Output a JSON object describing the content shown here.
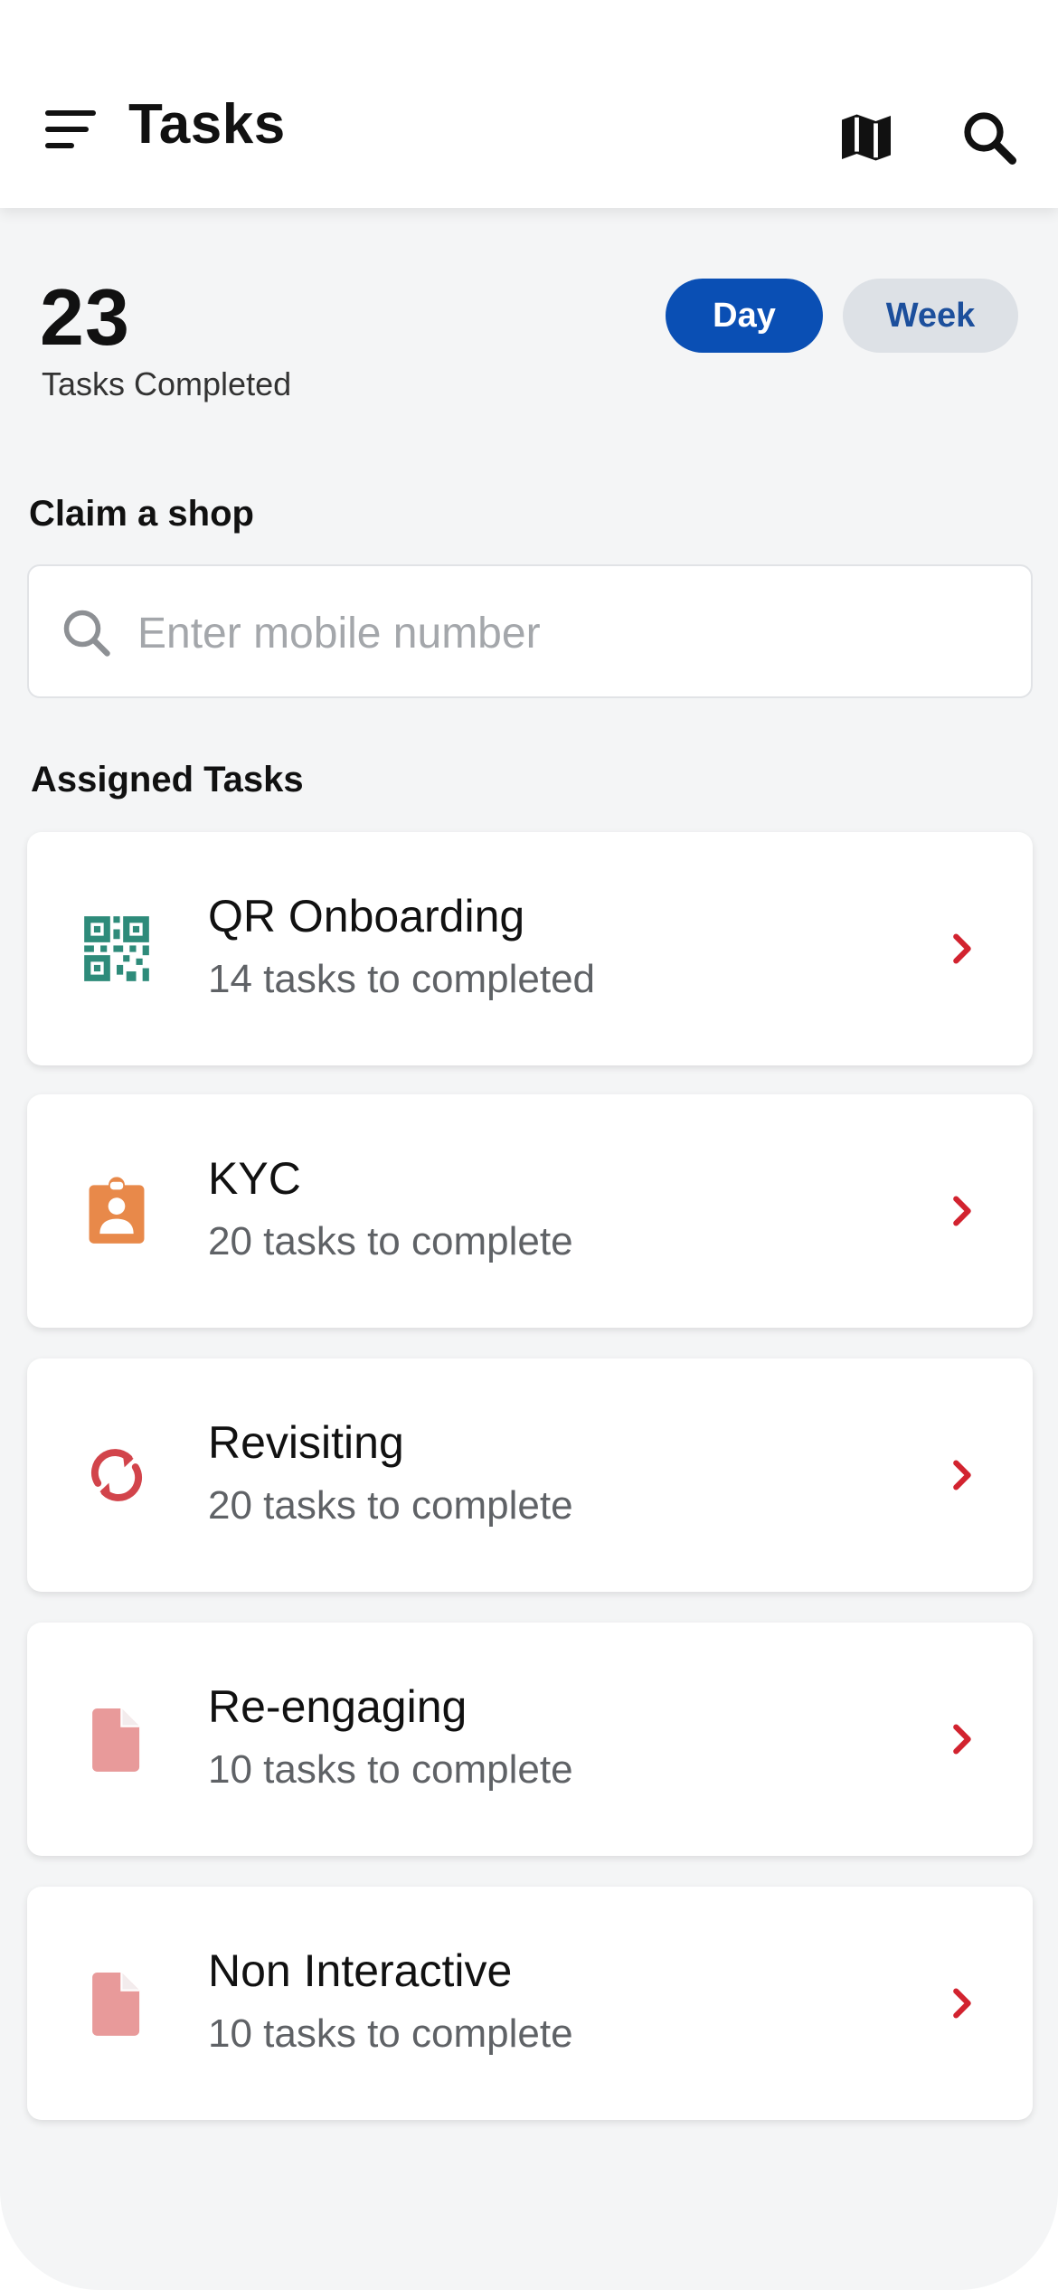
{
  "header": {
    "title": "Tasks",
    "icons": {
      "menu": "menu-icon",
      "map": "map-icon",
      "search": "search-icon"
    }
  },
  "stats": {
    "count": "23",
    "label": "Tasks Completed",
    "toggle": {
      "day": "Day",
      "week": "Week",
      "selected": "Day"
    }
  },
  "claim": {
    "title": "Claim a shop",
    "placeholder": "Enter mobile number",
    "value": ""
  },
  "assigned": {
    "title": "Assigned Tasks",
    "items": [
      {
        "title": "QR Onboarding",
        "subtitle": "14 tasks to completed",
        "icon": "qr-code-icon",
        "color": "#2e8b7a"
      },
      {
        "title": "KYC",
        "subtitle": "20 tasks to complete",
        "icon": "id-badge-icon",
        "color": "#e8894a"
      },
      {
        "title": "Revisiting",
        "subtitle": "20 tasks to complete",
        "icon": "refresh-icon",
        "color": "#d2444b"
      },
      {
        "title": "Re-engaging",
        "subtitle": "10 tasks to complete",
        "icon": "document-icon",
        "color": "#e89a9a"
      },
      {
        "title": "Non Interactive",
        "subtitle": "10 tasks to complete",
        "icon": "document-icon",
        "color": "#e89a9a"
      }
    ]
  },
  "colors": {
    "primary": "#0a4fb4",
    "toggle_inactive_bg": "#dde1e6",
    "chevron": "#d2232f",
    "background": "#f4f5f6"
  }
}
